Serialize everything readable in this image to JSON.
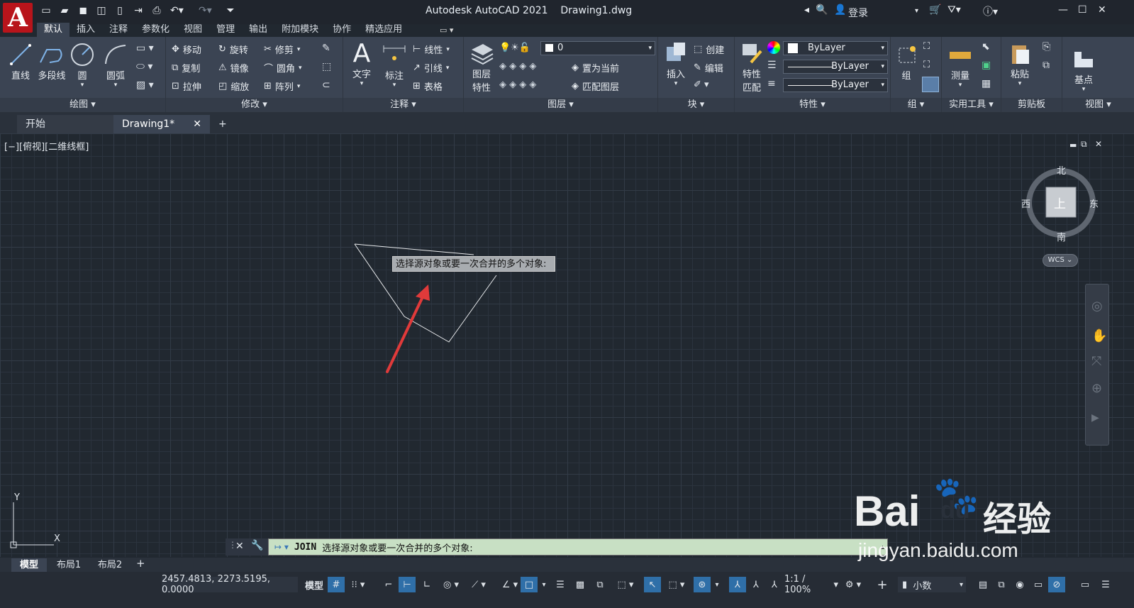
{
  "app": {
    "logo": "A",
    "title": "Autodesk AutoCAD 2021",
    "file": "Drawing1.dwg",
    "login": "登录"
  },
  "ribbon_tabs": [
    "默认",
    "插入",
    "注释",
    "参数化",
    "视图",
    "管理",
    "输出",
    "附加模块",
    "协作",
    "精选应用"
  ],
  "panels": {
    "draw": {
      "title": "绘图",
      "line": "直线",
      "polyline": "多段线",
      "circle": "圆",
      "arc": "圆弧"
    },
    "modify": {
      "title": "修改",
      "move": "移动",
      "rotate": "旋转",
      "trim": "修剪",
      "copy": "复制",
      "mirror": "镜像",
      "fillet": "圆角",
      "stretch": "拉伸",
      "scale": "缩放",
      "array": "阵列"
    },
    "annotation": {
      "title": "注释",
      "text": "文字",
      "dimension": "标注",
      "linear": "线性",
      "leader": "引线",
      "table": "表格"
    },
    "layers": {
      "title": "图层",
      "properties": "图层\n特性",
      "prop1": "图层",
      "prop2": "特性",
      "current_layer": "0",
      "make_current": "置为当前",
      "match_layer": "匹配图层"
    },
    "block": {
      "title": "块",
      "insert": "插入",
      "create": "创建",
      "edit": "编辑"
    },
    "properties": {
      "title": "特性",
      "match1": "特性",
      "match2": "匹配",
      "color": "ByLayer",
      "linetype": "ByLayer",
      "lineweight": "ByLayer"
    },
    "groups": {
      "title": "组",
      "group": "组"
    },
    "utilities": {
      "title": "实用工具",
      "measure": "测量"
    },
    "clipboard": {
      "title": "剪贴板",
      "paste": "粘贴"
    },
    "view": {
      "title": "视图",
      "base": "基点"
    }
  },
  "doc_tabs": {
    "start": "开始",
    "drawing": "Drawing1*"
  },
  "viewport": {
    "label": "[−][俯视][二维线框]",
    "tooltip": "选择源对象或要一次合并的多个对象:"
  },
  "viewcube": {
    "north": "北",
    "south": "南",
    "east": "东",
    "west": "西",
    "face": "上",
    "wcs": "WCS"
  },
  "ucs": {
    "y": "Y",
    "x": "X"
  },
  "command": {
    "name": "JOIN",
    "prompt": "选择源对象或要一次合并的多个对象:"
  },
  "layout_tabs": [
    "模型",
    "布局1",
    "布局2"
  ],
  "status": {
    "coords": "2457.4813, 2273.5195, 0.0000",
    "model": "模型",
    "scale": "1:1 / 100%",
    "units": "小数"
  },
  "watermark": {
    "brand": "Bai",
    "du": "du",
    "cn": "经验",
    "url": "jingyan.baidu.com"
  },
  "colors": {
    "accent": "#2f6fa8",
    "logo": "#b8141b",
    "command_bg": "#c8e0c4",
    "arrow": "#e03a3a"
  }
}
